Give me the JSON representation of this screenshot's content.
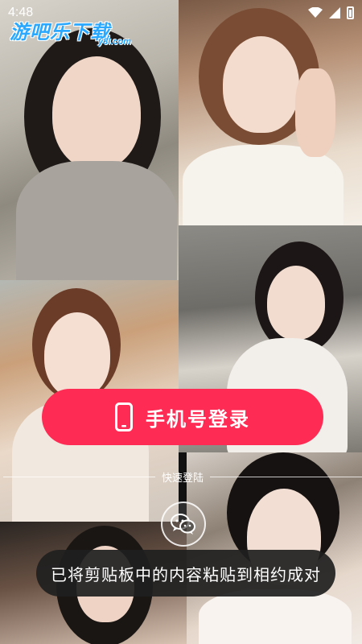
{
  "status_bar": {
    "time": "4:48"
  },
  "watermark": {
    "brand": "游吧乐下载",
    "domain": "y8l.com"
  },
  "login": {
    "button_label": "手机号登录",
    "icon": "phone-icon"
  },
  "quick_login": {
    "label": "快速登陆",
    "wechat_icon": "wechat-icon"
  },
  "toast": {
    "message": "已将剪贴板中的内容粘贴到相约成对"
  },
  "colors": {
    "accent": "#fe2c55",
    "watermark": "#2aa8ff",
    "toast_bg": "#202020"
  }
}
